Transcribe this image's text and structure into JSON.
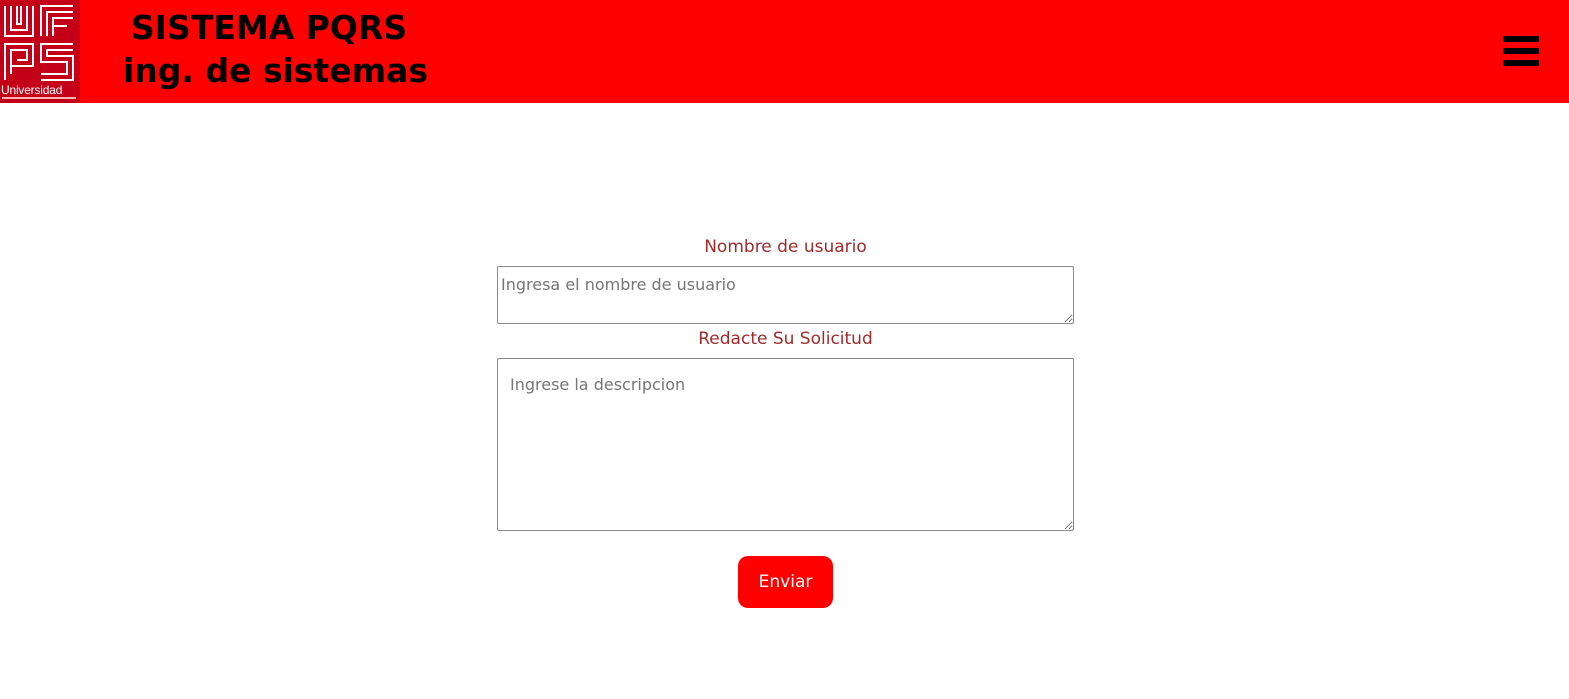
{
  "header": {
    "logo_text": "Universidad",
    "logo_icon": "ufps-logo-icon",
    "title_line1": "SISTEMA PQRS",
    "title_line2": "ing. de sistemas",
    "menu_icon": "hamburger-menu-icon"
  },
  "form": {
    "username_label": "Nombre de usuario",
    "username_placeholder": "Ingresa el nombre de usuario",
    "description_label": "Redacte Su Solicitud",
    "description_placeholder": "Ingrese la descripcion",
    "submit_label": "Enviar"
  },
  "colors": {
    "header_bg": "#ff0000",
    "label_color": "#9e2a2a",
    "button_bg": "#ff0000"
  }
}
